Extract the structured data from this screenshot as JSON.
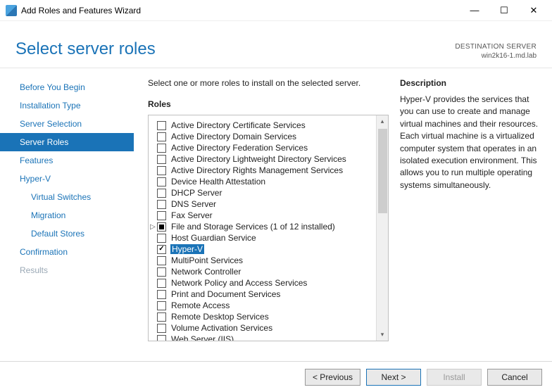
{
  "window": {
    "title": "Add Roles and Features Wizard"
  },
  "header": {
    "page_title": "Select server roles",
    "destination_label": "DESTINATION SERVER",
    "destination_value": "win2k16-1.md.lab"
  },
  "nav": {
    "items": [
      {
        "label": "Before You Begin",
        "state": "normal"
      },
      {
        "label": "Installation Type",
        "state": "normal"
      },
      {
        "label": "Server Selection",
        "state": "normal"
      },
      {
        "label": "Server Roles",
        "state": "active"
      },
      {
        "label": "Features",
        "state": "normal"
      },
      {
        "label": "Hyper-V",
        "state": "normal"
      },
      {
        "label": "Virtual Switches",
        "state": "sub"
      },
      {
        "label": "Migration",
        "state": "sub"
      },
      {
        "label": "Default Stores",
        "state": "sub"
      },
      {
        "label": "Confirmation",
        "state": "normal"
      },
      {
        "label": "Results",
        "state": "disabled"
      }
    ]
  },
  "content": {
    "instruction": "Select one or more roles to install on the selected server.",
    "roles_label": "Roles",
    "description_label": "Description",
    "description_text": "Hyper-V provides the services that you can use to create and manage virtual machines and their resources. Each virtual machine is a virtualized computer system that operates in an isolated execution environment. This allows you to run multiple operating systems simultaneously."
  },
  "roles": [
    {
      "label": "Active Directory Certificate Services",
      "checked": false
    },
    {
      "label": "Active Directory Domain Services",
      "checked": false
    },
    {
      "label": "Active Directory Federation Services",
      "checked": false
    },
    {
      "label": "Active Directory Lightweight Directory Services",
      "checked": false
    },
    {
      "label": "Active Directory Rights Management Services",
      "checked": false
    },
    {
      "label": "Device Health Attestation",
      "checked": false
    },
    {
      "label": "DHCP Server",
      "checked": false
    },
    {
      "label": "DNS Server",
      "checked": false
    },
    {
      "label": "Fax Server",
      "checked": false
    },
    {
      "label": "File and Storage Services (1 of 12 installed)",
      "checked": "indeterminate",
      "expandable": true
    },
    {
      "label": "Host Guardian Service",
      "checked": false
    },
    {
      "label": "Hyper-V",
      "checked": true,
      "selected": true
    },
    {
      "label": "MultiPoint Services",
      "checked": false
    },
    {
      "label": "Network Controller",
      "checked": false
    },
    {
      "label": "Network Policy and Access Services",
      "checked": false
    },
    {
      "label": "Print and Document Services",
      "checked": false
    },
    {
      "label": "Remote Access",
      "checked": false
    },
    {
      "label": "Remote Desktop Services",
      "checked": false
    },
    {
      "label": "Volume Activation Services",
      "checked": false
    },
    {
      "label": "Web Server (IIS)",
      "checked": false
    }
  ],
  "footer": {
    "previous": "< Previous",
    "next": "Next >",
    "install": "Install",
    "cancel": "Cancel"
  }
}
